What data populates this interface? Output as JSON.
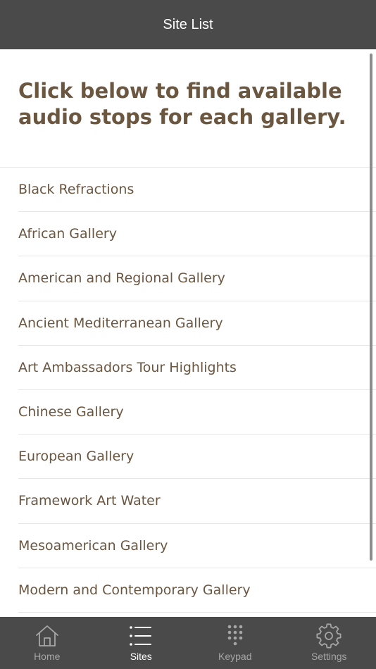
{
  "header": {
    "title": "Site List"
  },
  "intro": {
    "text": "Click below to find available audio stops for each gallery."
  },
  "galleries": [
    {
      "label": "Black Refractions"
    },
    {
      "label": "African Gallery"
    },
    {
      "label": "American and Regional Gallery"
    },
    {
      "label": "Ancient Mediterranean Gallery"
    },
    {
      "label": "Art Ambassadors Tour Highlights"
    },
    {
      "label": "Chinese Gallery"
    },
    {
      "label": "European Gallery"
    },
    {
      "label": "Framework Art Water"
    },
    {
      "label": "Mesoamerican Gallery"
    },
    {
      "label": "Modern and Contemporary Gallery"
    }
  ],
  "tabbar": {
    "tabs": [
      {
        "label": "Home",
        "icon": "home-icon"
      },
      {
        "label": "Sites",
        "icon": "list-icon",
        "active": true
      },
      {
        "label": "Keypad",
        "icon": "keypad-icon"
      },
      {
        "label": "Settings",
        "icon": "gear-icon"
      }
    ]
  },
  "colors": {
    "bar": "#4a4a4a",
    "text_brown": "#6b5640",
    "active_tab": "#ffffff",
    "inactive_tab": "#a6a6a6",
    "divider": "#e6e6e6"
  }
}
